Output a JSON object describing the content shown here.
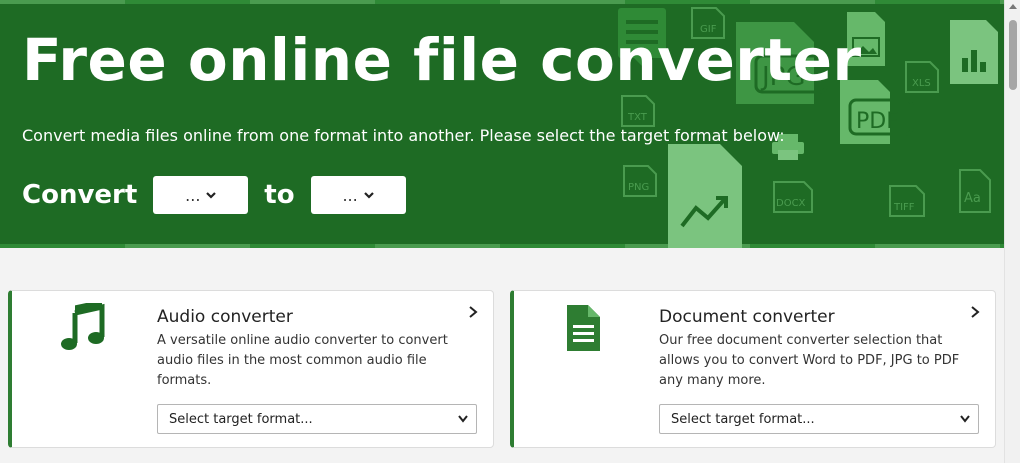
{
  "hero": {
    "title": "Free online file converter",
    "subtitle": "Convert media files online from one format into another. Please select the target format below:",
    "convert_label": "Convert",
    "to_label": "to",
    "from_value": "...",
    "to_value": "...",
    "bg_color": "#1e6b24",
    "deco_labels": {
      "gif": "GIF",
      "jpg": "JPG",
      "xls": "XLS",
      "txt": "TXT",
      "pdf": "PDF",
      "png": "PNG",
      "docx": "DOCX",
      "tiff": "TIFF",
      "font": "Aa"
    }
  },
  "cards": [
    {
      "title": "Audio converter",
      "description": "A versatile online audio converter to convert audio files in the most common audio file formats.",
      "select_placeholder": "Select target format...",
      "icon": "music-note-icon"
    },
    {
      "title": "Document converter",
      "description": "Our free document converter selection that allows you to convert Word to PDF, JPG to PDF any many more.",
      "select_placeholder": "Select target format...",
      "icon": "document-icon"
    }
  ],
  "accent_color": "#2e7d32"
}
